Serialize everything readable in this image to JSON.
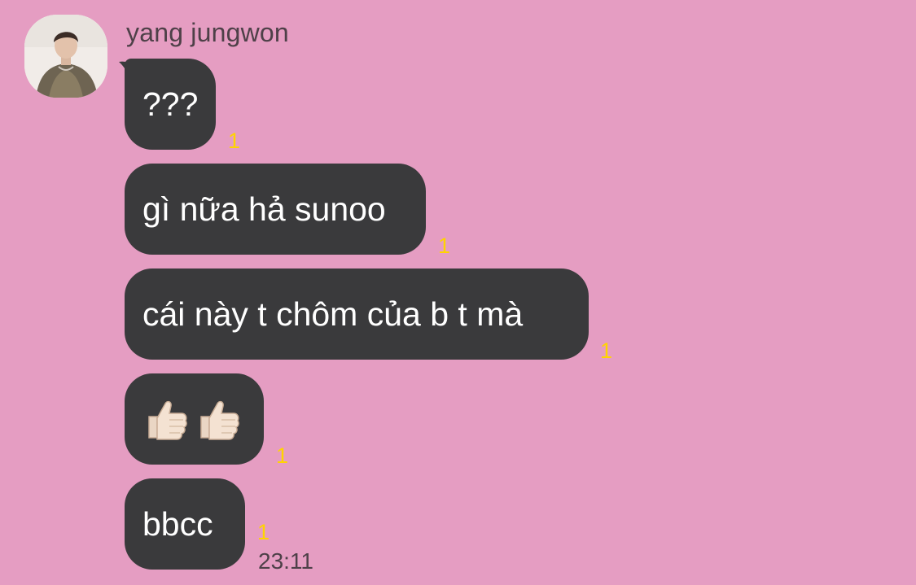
{
  "chat": {
    "sender_name": "yang jungwon",
    "messages": [
      {
        "text": "???",
        "unread": "1"
      },
      {
        "text": "gì nữa hả sunoo",
        "unread": "1"
      },
      {
        "text": "cái này t chôm của b t mà",
        "unread": "1"
      },
      {
        "text": "👍🏻👍🏻",
        "unread": "1"
      },
      {
        "text": "bbcc",
        "unread": "1"
      }
    ],
    "timestamp": "23:11"
  },
  "colors": {
    "background": "#e59dc2",
    "bubble": "#3a3a3c",
    "unread": "#ffd400"
  }
}
